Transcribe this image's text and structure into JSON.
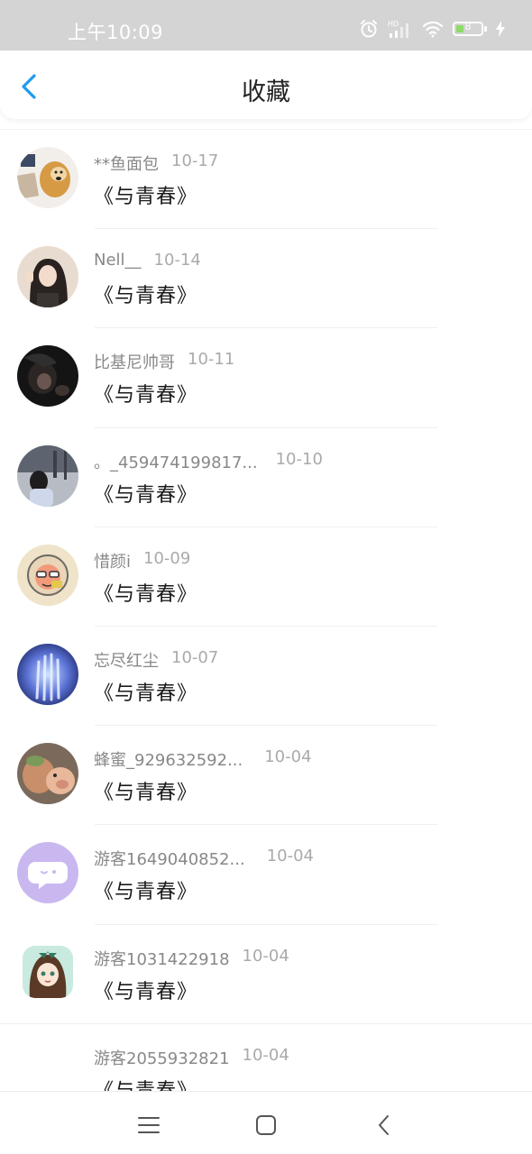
{
  "status_bar": {
    "time": "上午10:09",
    "battery_level": "8",
    "icons": [
      "alarm-icon",
      "hd-signal-icon",
      "wifi-icon",
      "battery-icon",
      "charging-icon"
    ]
  },
  "header": {
    "back_icon": "chevron-left-icon",
    "title": "收藏",
    "accent_color": "#1e9bf0"
  },
  "favorites": [
    {
      "name": "**鱼面包",
      "date": "10-17",
      "title": "《与青春》",
      "avatar": "dog-meme-avatar"
    },
    {
      "name": "Nell__",
      "date": "10-14",
      "title": "《与青春》",
      "avatar": "girl-photo-avatar"
    },
    {
      "name": "比基尼帅哥",
      "date": "10-11",
      "title": "《与青春》",
      "avatar": "dark-photo-avatar"
    },
    {
      "name": "。_459474199817...",
      "date": "10-10",
      "title": "《与青春》",
      "avatar": "girl-street-avatar"
    },
    {
      "name": "惜颜i",
      "date": "10-09",
      "title": "《与青春》",
      "avatar": "cartoon-avatar"
    },
    {
      "name": "忘尽红尘",
      "date": "10-07",
      "title": "《与青春》",
      "avatar": "blue-hand-avatar"
    },
    {
      "name": "蜂蜜_929632592...",
      "date": "10-04",
      "title": "《与青春》",
      "avatar": "pig-avatar"
    },
    {
      "name": "游客1649040852...",
      "date": "10-04",
      "title": "《与青春》",
      "avatar": "default-guest-avatar"
    },
    {
      "name": "游客1031422918",
      "date": "10-04",
      "title": "《与青春》",
      "avatar": "anime-girl-avatar"
    },
    {
      "name": "游客2055932821",
      "date": "10-04",
      "title": "《与青春》",
      "avatar": "blank-avatar"
    }
  ],
  "system_nav": {
    "icons": [
      "menu-icon",
      "home-icon",
      "back-icon"
    ]
  }
}
